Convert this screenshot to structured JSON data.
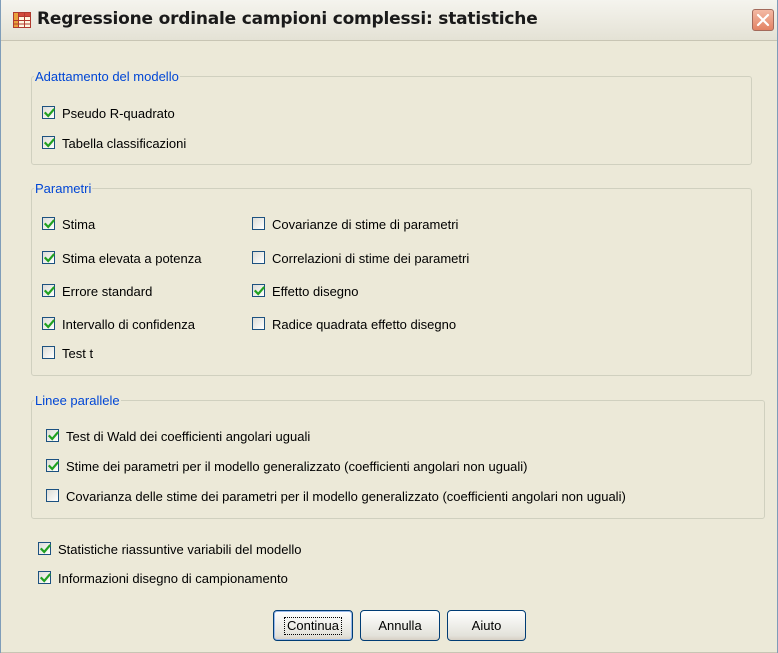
{
  "window": {
    "title": "Regressione ordinale campioni complessi: statistiche"
  },
  "icons": {
    "app": "table-grid-icon",
    "close": "close-icon",
    "check": "checkmark-icon"
  },
  "colors": {
    "group_label": "#0046d5",
    "check": "#21a121",
    "dialog_bg": "#ece9d8"
  },
  "groups": {
    "adattamento": {
      "label": "Adattamento del modello",
      "items": [
        {
          "label": "Pseudo R-quadrato",
          "checked": true
        },
        {
          "label": "Tabella classificazioni",
          "checked": true
        }
      ]
    },
    "parametri": {
      "label": "Parametri",
      "left": [
        {
          "label": "Stima",
          "checked": true
        },
        {
          "label": "Stima elevata a potenza",
          "checked": true
        },
        {
          "label": "Errore standard",
          "checked": true
        },
        {
          "label": "Intervallo di confidenza",
          "checked": true
        },
        {
          "label": "Test t",
          "checked": false
        }
      ],
      "right": [
        {
          "label": "Covarianze di stime di parametri",
          "checked": false
        },
        {
          "label": "Correlazioni di stime dei parametri",
          "checked": false
        },
        {
          "label": "Effetto disegno",
          "checked": true
        },
        {
          "label": "Radice quadrata effetto disegno",
          "checked": false
        }
      ]
    },
    "linee": {
      "label": "Linee parallele",
      "items": [
        {
          "label": "Test di Wald dei coefficienti angolari uguali",
          "checked": true
        },
        {
          "label": "Stime dei parametri per il modello generalizzato (coefficienti angolari non uguali)",
          "checked": true
        },
        {
          "label": "Covarianza delle stime dei parametri per il modello generalizzato (coefficienti angolari non uguali)",
          "checked": false
        }
      ]
    }
  },
  "standalone": [
    {
      "label": "Statistiche riassuntive variabili del modello",
      "checked": true
    },
    {
      "label": "Informazioni disegno di campionamento",
      "checked": true
    }
  ],
  "buttons": {
    "continua": "Continua",
    "annulla": "Annulla",
    "aiuto": "Aiuto"
  }
}
